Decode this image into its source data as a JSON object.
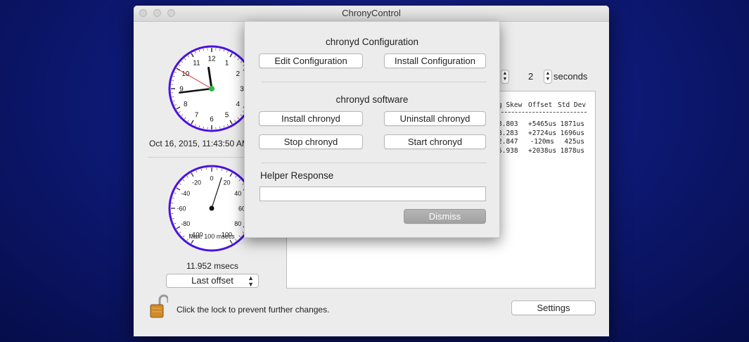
{
  "window": {
    "title": "ChronyControl"
  },
  "clock": {
    "numbers": [
      "12",
      "1",
      "2",
      "3",
      "4",
      "5",
      "6",
      "7",
      "8",
      "9",
      "10",
      "11"
    ],
    "datetime": "Oct 16, 2015, 11:43:50 AM",
    "time": {
      "hours": 11,
      "minutes": 43,
      "seconds": 50
    }
  },
  "gauge": {
    "labels": [
      "0",
      "20",
      "40",
      "60",
      "80",
      "100",
      "-20",
      "-40",
      "-60",
      "-80",
      "-100"
    ],
    "max_label": "Max: 100 msecs",
    "offset_msecs": 11.952,
    "readout": "11.952 msecs"
  },
  "offset_select": {
    "value": "Last offset"
  },
  "interval": {
    "value": "2",
    "unit": "seconds"
  },
  "sources_table": {
    "headers": [
      "g Skew",
      "Offset",
      "Std Dev"
    ],
    "rows": [
      [
        "3.803",
        "+5465us",
        "1871us"
      ],
      [
        "8.283",
        "+2724us",
        "1696us"
      ],
      [
        "2.847",
        "-120ms",
        "425us"
      ],
      [
        "5.938",
        "+2038us",
        "1878us"
      ]
    ]
  },
  "lock": {
    "message": "Click the lock to prevent further changes."
  },
  "settings_button": {
    "label": "Settings"
  },
  "sheet": {
    "config_heading": "chronyd Configuration",
    "edit_config": "Edit Configuration",
    "install_config": "Install Configuration",
    "software_heading": "chronyd software",
    "install_chronyd": "Install chronyd",
    "uninstall_chronyd": "Uninstall chronyd",
    "stop_chronyd": "Stop chronyd",
    "start_chronyd": "Start chronyd",
    "helper_label": "Helper Response",
    "helper_value": "",
    "dismiss": "Dismiss"
  },
  "colors": {
    "clock_rim": "#4a12e0",
    "second_hand": "#d42020",
    "center_dot": "#2db84a",
    "background": "#0e1a78"
  },
  "icons": [
    "lock-icon",
    "chevron-updown-icon"
  ]
}
